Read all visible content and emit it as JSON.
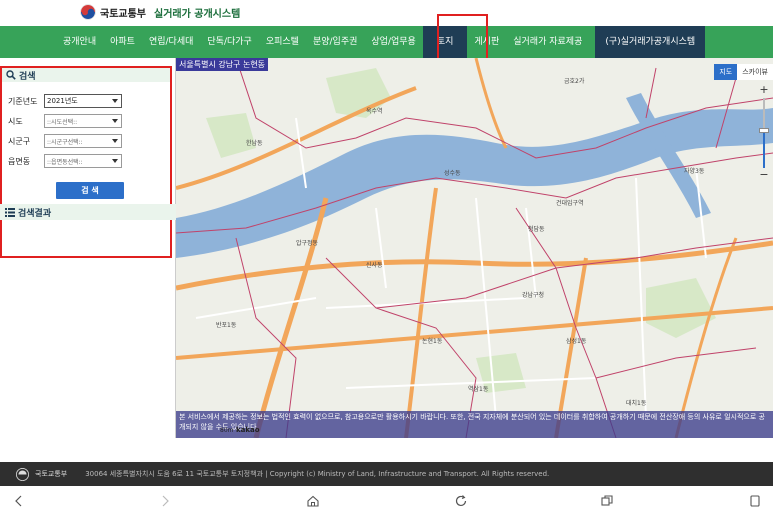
{
  "header": {
    "ministry": "국토교통부",
    "system_title": "실거래가 공개시스템"
  },
  "nav": {
    "items": [
      "공개안내",
      "아파트",
      "연립/다세대",
      "단독/다가구",
      "오피스텔",
      "분양/입주권",
      "상업/업무용",
      "토지",
      "게시판",
      "실거래가 자료제공",
      "(구)실거래가공개시스템"
    ],
    "active": "토지"
  },
  "sidebar": {
    "search_title": "검색",
    "fields": [
      {
        "label": "기준년도",
        "value": "2021년도"
      },
      {
        "label": "시도",
        "value": "::시도선택::"
      },
      {
        "label": "시군구",
        "value": "::시군구선택::"
      },
      {
        "label": "읍면동",
        "value": "::읍면동선택::"
      }
    ],
    "search_button": "검 색",
    "results_title": "검색결과"
  },
  "map": {
    "location": "서울특별시 강남구 논현동",
    "type_map": "지도",
    "type_sky": "스카이뷰",
    "zoom_in": "+",
    "zoom_out": "−",
    "scale": "80m",
    "provider": "kakao",
    "notice": "본 서비스에서 제공하는 정보는 법적인 효력이 없으므로, 참고용으로만 활용하시기 바랍니다. 또한, 전국 지자체에 분산되어 있는 데이터를 취합하여 공개하기 때문에 전산장애 등의 사유로 일시적으로 공개되지 않을 수도 있습니다.",
    "labels": [
      {
        "name": "label-1",
        "text": "금호2가"
      },
      {
        "name": "label-2",
        "text": "옥수역"
      },
      {
        "name": "label-3",
        "text": "압구정동"
      },
      {
        "name": "label-4",
        "text": "신사동"
      },
      {
        "name": "label-5",
        "text": "논현1동"
      },
      {
        "name": "label-6",
        "text": "청담동"
      },
      {
        "name": "label-7",
        "text": "삼성1동"
      },
      {
        "name": "label-8",
        "text": "강남구청"
      },
      {
        "name": "label-9",
        "text": "성수동"
      },
      {
        "name": "label-10",
        "text": "반포1동"
      },
      {
        "name": "label-11",
        "text": "한남동"
      },
      {
        "name": "label-12",
        "text": "자양3동"
      },
      {
        "name": "label-13",
        "text": "대치1동"
      },
      {
        "name": "label-14",
        "text": "역삼1동"
      },
      {
        "name": "label-15",
        "text": "건대입구역"
      }
    ]
  },
  "footer": {
    "ministry": "국토교통부",
    "text": "30064 세종특별자치시 도움 6로 11 국토교통부 토지정책과  |  Copyright (c) Ministry of Land, Infrastructure and Transport. All Rights reserved."
  },
  "colors": {
    "nav_green": "#37a359",
    "nav_dark": "#1f3d55",
    "highlight_red": "#e02020",
    "river": "#8fb3d9",
    "road_orange": "#f2a65a"
  },
  "icons": {
    "search": "search-icon",
    "list": "list-icon",
    "back": "back-icon",
    "forward": "forward-icon",
    "home": "home-icon",
    "reload": "reload-icon",
    "tabs": "tabs-icon",
    "bookmark": "bookmark-icon"
  }
}
